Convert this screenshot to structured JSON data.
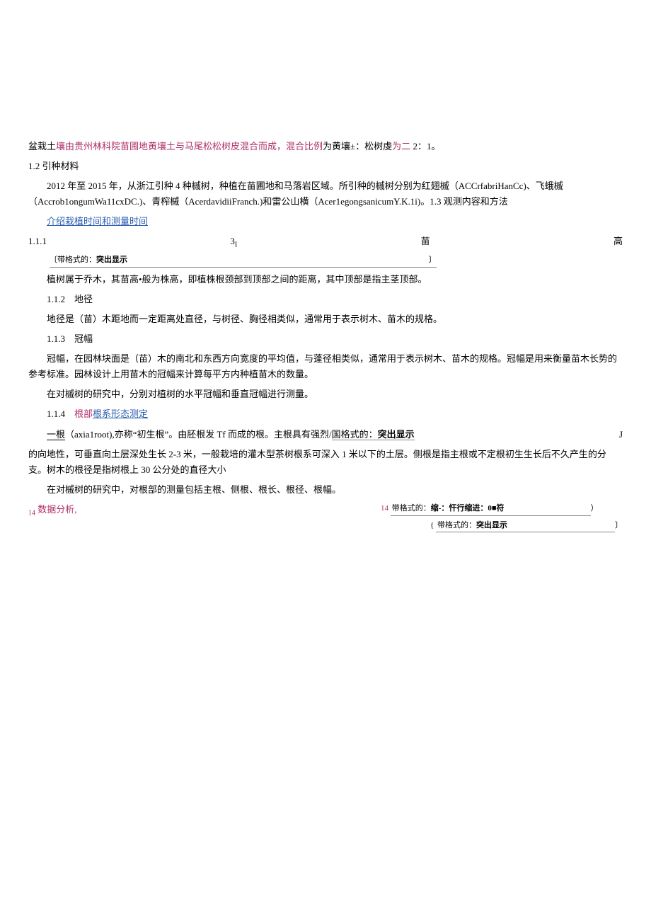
{
  "p1": {
    "a": "盆栽土",
    "b": "壤由贵州林科院苗圃地黄壤土与马尾松松树皮混合而成，混合比例",
    "c": "为黄壤±：松树虔",
    "d": "为二",
    "e": " 2：1。"
  },
  "h12": "1.2 引种材料",
  "p2": "2012 年至 2015 年，从浙江引种 4 种槭树，种植在苗圃地和马落岩区域。所引种的槭树分别为红翅槭（ACCrfabriHanCc)、飞蛾槭（Accrob1ongumWa11cxDC.)、青榨槭（AcerdavidiiFranch.)和雷公山横（Acer1egongsanicumY.K.1i)。1.3 观测内容和方法",
  "link1": "介绍栽植时间和测量时间",
  "row111": {
    "left": "1.1.1",
    "mid": "3",
    "r1": "苗",
    "r2": "高"
  },
  "fmt1": {
    "open": "〔",
    "label": "带格式的：",
    "val": "突出显示",
    "close": "〕"
  },
  "p3": "植树属于乔木，其苗高•般为株高，即植株根颈部到顶部之间的距离，其中顶部是指主茎顶部。",
  "h112": "1.1.2 地径",
  "p4": "地径是（苗）木距地而一定距离处直径，与树径、胸径相类似，通常用于表示树木、苗木的规格。",
  "h113": "1.1.3 冠幅",
  "p5": "冠幅，在园林块面是（苗）木的南北和东西方向宽度的平均值，与蓬径相类似，通常用于表示树木、苗木的规格。冠幅是用来衡量苗木长势的参考标准。园林设计上用苗木的冠幅来计算每平方内种植苗木的数量。",
  "p6": "在对槭树的研究中，分别对植树的水平冠幅和垂直冠幅进行测量。",
  "h114": {
    "num": "1.1.4 ",
    "red": "根部",
    "link": "根系形态测定"
  },
  "p7": {
    "a": "一根",
    "b": "（axia1root),亦称“初生根”。由胚根发 Tf 而成的根。主根具有强烈/",
    "fmtlabel": "国格式的：",
    "fmtval": "突出显示",
    "j": "J"
  },
  "p8": "的向地性，可垂直向土层深处生长 2-3 米，一般栽培的灌木型茶树根系可深入 1 米以下的土层。侧根是指主根或不定根初生生长后不久产生的分支。树木的根径是指树根上 30 公分处的直径大小",
  "p9": "在对槭树的研究中，对根部的测量包括主根、侧根、根长、根径、根幅。",
  "bottom": {
    "left_sub": "14",
    "left_label": " 数据分析,",
    "right1_num": "14 ",
    "right1_label": "带格式的：",
    "right1a": "缩-：忓行缩进：0",
    "right1b": "符",
    "right1_close": "）",
    "right2_open": "{ ",
    "right2_label": "带格式的：",
    "right2_val": "突出显示",
    "right2_close": "〕"
  }
}
